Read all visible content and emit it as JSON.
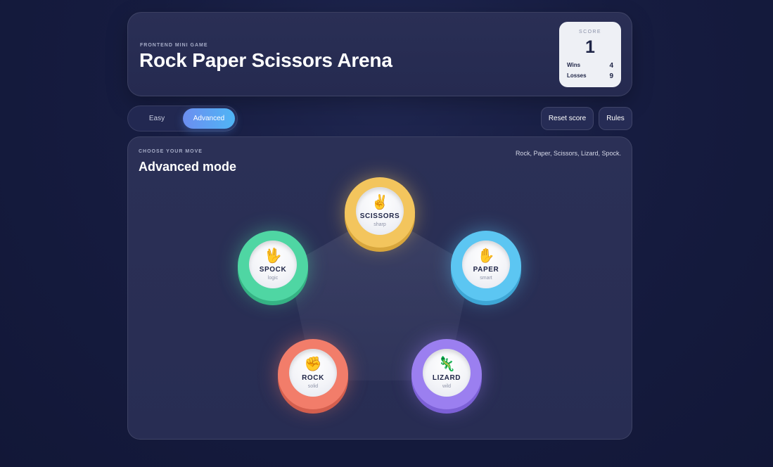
{
  "header": {
    "eyebrow": "FRONTEND MINI GAME",
    "title": "Rock Paper Scissors Arena"
  },
  "score": {
    "label": "SCORE",
    "value": "1",
    "wins_label": "Wins",
    "wins": "4",
    "losses_label": "Losses",
    "losses": "9"
  },
  "modes": {
    "easy": "Easy",
    "advanced": "Advanced",
    "selected": "Advanced"
  },
  "actions": {
    "reset": "Reset score",
    "rules": "Rules"
  },
  "arena": {
    "eyebrow": "CHOOSE YOUR MOVE",
    "title": "Advanced mode",
    "hint": "Rock, Paper, Scissors, Lizard, Spock."
  },
  "moves": {
    "scissors": {
      "emoji": "✌️",
      "name": "SCISSORS",
      "sub": "sharp",
      "color": "#f3c55d"
    },
    "spock": {
      "emoji": "🖖",
      "name": "SPOCK",
      "sub": "logic",
      "color": "#4fd6a3"
    },
    "paper": {
      "emoji": "✋",
      "name": "PAPER",
      "sub": "smart",
      "color": "#5cc6f2"
    },
    "rock": {
      "emoji": "✊",
      "name": "ROCK",
      "sub": "solid",
      "color": "#f27d6a"
    },
    "lizard": {
      "emoji": "🦎",
      "name": "LIZARD",
      "sub": "wild",
      "color": "#9b7ff0"
    }
  },
  "colors": {
    "background": "#161c40",
    "card": "#2a2f55",
    "accent_start": "#6c8ef0",
    "accent_end": "#4fb5f5"
  }
}
